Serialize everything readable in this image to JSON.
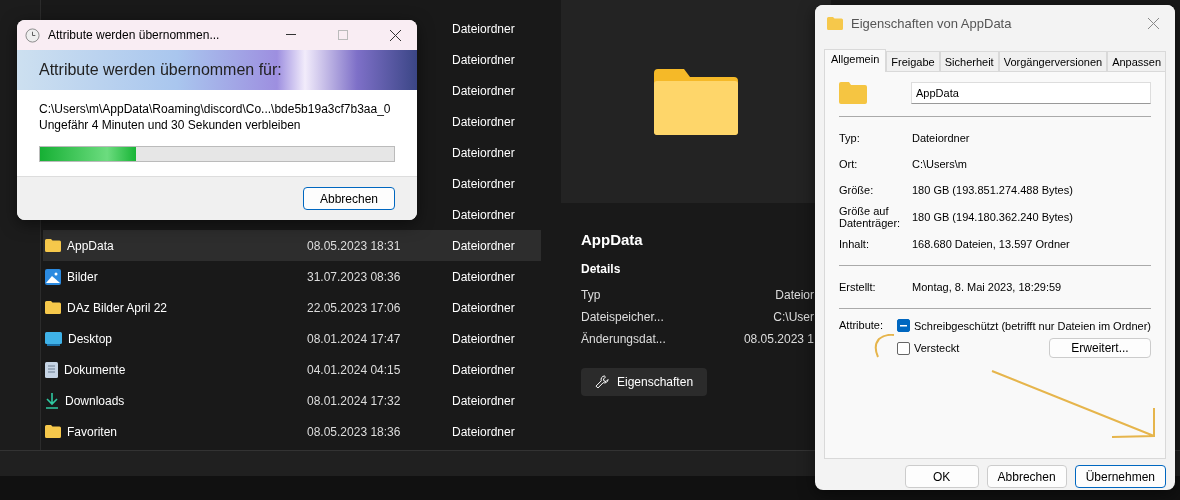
{
  "explorer": {
    "rows": [
      {
        "type": "Dateiordner",
        "selected": false
      },
      {
        "type": "Dateiordner",
        "selected": false
      },
      {
        "type": "Dateiordner",
        "selected": false
      },
      {
        "type": "Dateiordner",
        "selected": false
      },
      {
        "type": "Dateiordner",
        "selected": false
      },
      {
        "type": "Dateiordner",
        "selected": false
      },
      {
        "type": "Dateiordner",
        "selected": false
      },
      {
        "kind": "folder",
        "name": "AppData",
        "date": "08.05.2023 18:31",
        "type": "Dateiordner",
        "selected": true
      },
      {
        "kind": "pictures",
        "name": "Bilder",
        "date": "31.07.2023 08:36",
        "type": "Dateiordner",
        "selected": false
      },
      {
        "kind": "folder",
        "name": "DAz Bilder April 22",
        "date": "22.05.2023 17:06",
        "type": "Dateiordner",
        "selected": false
      },
      {
        "kind": "desktop",
        "name": "Desktop",
        "date": "08.01.2024 17:47",
        "type": "Dateiordner",
        "selected": false
      },
      {
        "kind": "documents",
        "name": "Dokumente",
        "date": "04.01.2024 04:15",
        "type": "Dateiordner",
        "selected": false
      },
      {
        "kind": "downloads",
        "name": "Downloads",
        "date": "08.01.2024 17:32",
        "type": "Dateiordner",
        "selected": false
      },
      {
        "kind": "folder",
        "name": "Favoriten",
        "date": "08.05.2023 18:36",
        "type": "Dateiordner",
        "selected": false
      }
    ]
  },
  "preview": {
    "title": "AppData",
    "section": "Details",
    "details": [
      {
        "label": "Typ",
        "value": "Dateior"
      },
      {
        "label": "Dateispeicher...",
        "value": "C:\\User"
      },
      {
        "label": "Änderungsdat...",
        "value": "08.05.2023 1"
      }
    ],
    "button": "Eigenschaften"
  },
  "progress_dialog": {
    "title": "Attribute werden übernommen...",
    "heading": "Attribute werden übernommen für:",
    "path": "C:\\Users\\m\\AppData\\Roaming\\discord\\Co...\\bde5b19a3cf7b3aa_0",
    "remaining": "Ungefähr 4 Minuten und 30 Sekunden verbleiben",
    "level": 0.27,
    "cancel": "Abbrechen"
  },
  "properties_dialog": {
    "title": "Eigenschaften von AppData",
    "tabs": [
      {
        "label": "Allgemein",
        "selected": true
      },
      {
        "label": "Freigabe",
        "selected": false
      },
      {
        "label": "Sicherheit",
        "selected": false
      },
      {
        "label": "Vorgängerversionen",
        "selected": false
      },
      {
        "label": "Anpassen",
        "selected": false
      }
    ],
    "name": "AppData",
    "groups": [
      [
        {
          "label": "Typ:",
          "value": "Dateiordner"
        },
        {
          "label": "Ort:",
          "value": "C:\\Users\\m"
        },
        {
          "label": "Größe:",
          "value": "180 GB (193.851.274.488 Bytes)"
        },
        {
          "label": "Größe auf Datenträger:",
          "value": "180 GB (194.180.362.240 Bytes)"
        },
        {
          "label": "Inhalt:",
          "value": "168.680 Dateien, 13.597 Ordner"
        }
      ],
      [
        {
          "label": "Erstellt:",
          "value": "Montag, 8. Mai 2023, 18:29:59"
        }
      ]
    ],
    "attributes_label": "Attribute:",
    "attributes": [
      {
        "label": "Schreibgeschützt (betrifft nur Dateien im Ordner)",
        "mixed": true
      },
      {
        "label": "Versteckt",
        "mixed": false
      }
    ],
    "advanced": "Erweitert...",
    "buttons": [
      {
        "label": "OK",
        "default": false
      },
      {
        "label": "Abbrechen",
        "default": false
      },
      {
        "label": "Übernehmen",
        "default": true
      }
    ]
  }
}
